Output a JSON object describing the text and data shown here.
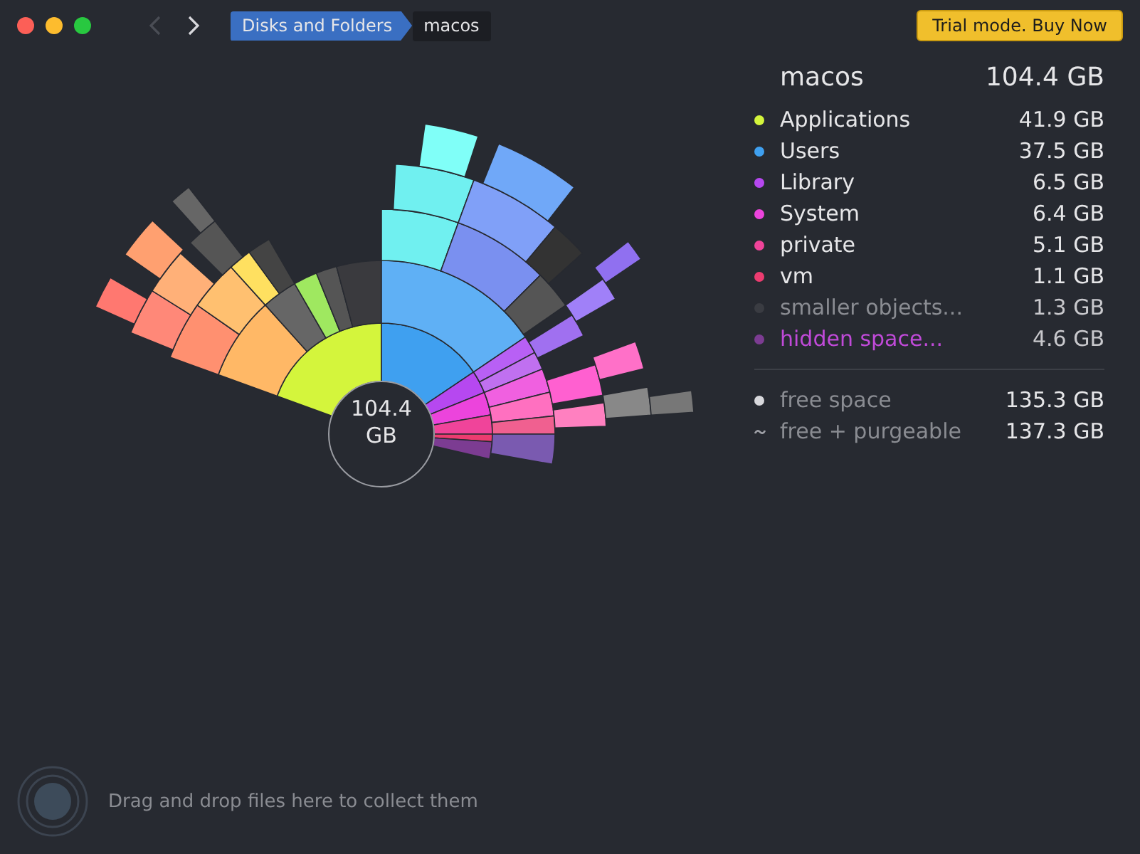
{
  "toolbar": {
    "nav": [
      {
        "kind": "back",
        "disabled": true
      },
      {
        "kind": "forward",
        "disabled": false
      }
    ],
    "breadcrumbs": [
      "Disks and Folders",
      "macos"
    ],
    "buy_button": "Trial mode. Buy Now"
  },
  "chart": {
    "center_label": "104.4 GB"
  },
  "summary": {
    "name": "macos",
    "size": "104.4 GB"
  },
  "items": [
    {
      "label": "Applications",
      "size": "41.9 GB",
      "color": "#d4f53c",
      "kind": "folder"
    },
    {
      "label": "Users",
      "size": "37.5 GB",
      "color": "#3fa0f0",
      "kind": "folder"
    },
    {
      "label": "Library",
      "size": "6.5 GB",
      "color": "#b648f0",
      "kind": "folder"
    },
    {
      "label": "System",
      "size": "6.4 GB",
      "color": "#ec44dc",
      "kind": "folder"
    },
    {
      "label": "private",
      "size": "5.1 GB",
      "color": "#f0449a",
      "kind": "folder"
    },
    {
      "label": "vm",
      "size": "1.1 GB",
      "color": "#ec3c70",
      "kind": "folder"
    },
    {
      "label": "smaller objects...",
      "size": "1.3 GB",
      "color": "#3a3c42",
      "kind": "smaller"
    },
    {
      "label": "hidden space...",
      "size": "4.6 GB",
      "color": "#7c3c92",
      "kind": "hidden"
    }
  ],
  "free": [
    {
      "label": "free space",
      "size": "135.3 GB",
      "kind": "free"
    },
    {
      "label": "free + purgeable",
      "size": "137.3 GB",
      "kind": "purgeable"
    }
  ],
  "drop_zone": "Drag and drop files here to collect them"
}
